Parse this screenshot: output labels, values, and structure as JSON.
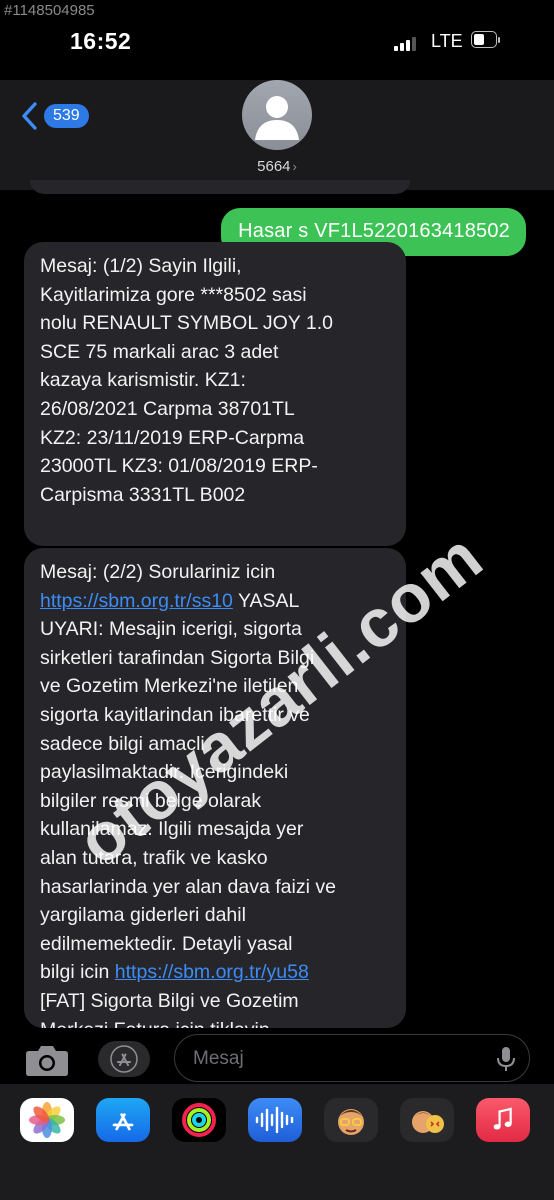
{
  "reference_id": "#1148504985",
  "status_bar": {
    "time": "16:52",
    "carrier": "LTE"
  },
  "header": {
    "back_count": "539",
    "contact_name": "5664",
    "contact_chevron": "›"
  },
  "messages": {
    "sent_text": "Hasar s VF1L5220163418502",
    "received_1": "Mesaj: (1/2) Sayin Ilgili,\nKayitlarimiza gore ***8502 sasi\nnolu RENAULT SYMBOL JOY 1.0\nSCE 75 markali arac 3 adet\nkazaya karismistir. KZ1:\n26/08/2021 Carpma 38701TL\nKZ2: 23/11/2019 ERP-Carpma\n23000TL KZ3: 01/08/2019 ERP-\nCarpisma 3331TL B002",
    "received_2_intro": "Mesaj: (2/2) Sorulariniz icin",
    "received_2_link1": "https://sbm.org.tr/ss10",
    "received_2_body": " YASAL\nUYARI: Mesajin icerigi, sigorta\nsirketleri tarafindan Sigorta Bilgi\nve Gozetim Merkezi'ne iletilen\nsigorta kayitlarindan ibarettir ve\nsadece bilgi amacli\npaylasilmaktadir. Icerigindeki\nbilgiler resmi belge olarak\nkullanilamaz. Ilgili mesajda yer\nalan tutara, trafik ve kasko\nhasarlarinda yer alan dava faizi ve\nyargilama giderleri dahil\nedilmemektedir. Detayli yasal\nbilgi icin ",
    "received_2_link2": "https://sbm.org.tr/yu58",
    "received_2_tail": "\n[FAT] Sigorta Bilgi ve Gozetim\nMerkezi Fatura icin tiklayin"
  },
  "watermark": "otoyazarli.com",
  "input": {
    "placeholder": "Mesaj"
  },
  "app_drawer": [
    "photos-app",
    "app-store",
    "activity-app",
    "audio-messages-app",
    "memoji-app",
    "memoji-stickers-app",
    "music-app"
  ],
  "colors": {
    "sent_bubble": "#3cc255",
    "received_bubble": "#26262a",
    "link": "#3d8cf6",
    "badge": "#2d7ae7"
  }
}
